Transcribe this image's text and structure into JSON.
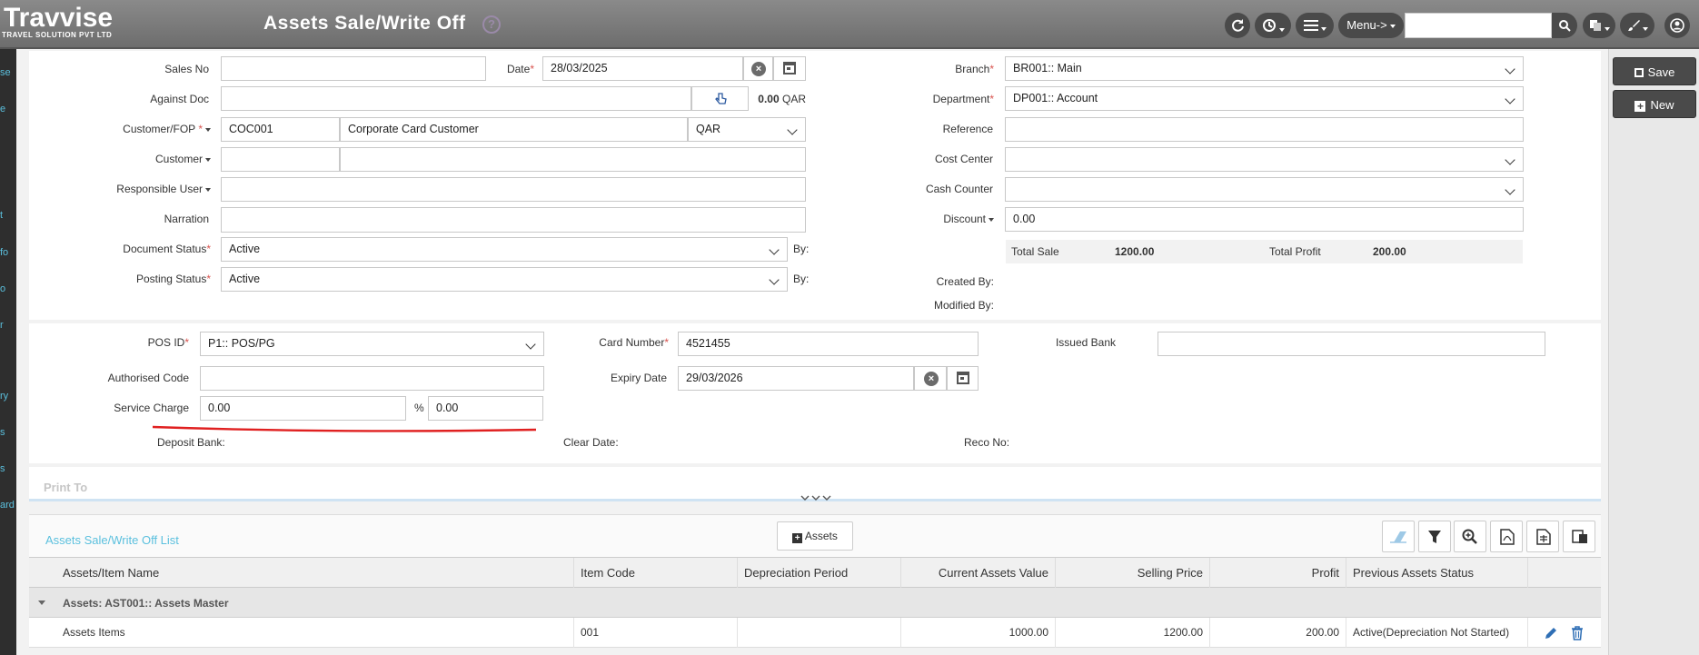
{
  "app": {
    "logo": "Travvise",
    "logo_sub": "TRAVEL SOLUTION PVT LTD",
    "title": "Assets Sale/Write Off",
    "help": "?",
    "menu_label": "Menu->",
    "search_placeholder": ""
  },
  "leftnav": [
    "se",
    "e",
    "t",
    "fo",
    "o",
    "r",
    "ry",
    "s",
    "s",
    "ard"
  ],
  "actions": {
    "save": "Save",
    "new": "New"
  },
  "form": {
    "sales_no": {
      "label": "Sales No",
      "value": ""
    },
    "date": {
      "label": "Date",
      "value": "28/03/2025"
    },
    "against_doc": {
      "label": "Against Doc",
      "amount": "0.00",
      "currency": "QAR"
    },
    "customer_fop": {
      "label": "Customer/FOP",
      "code": "COC001",
      "name": "Corporate Card Customer",
      "currency": "QAR"
    },
    "customer": {
      "label": "Customer",
      "code": "",
      "name": ""
    },
    "responsible_user": {
      "label": "Responsible User",
      "value": ""
    },
    "narration": {
      "label": "Narration",
      "value": ""
    },
    "document_status": {
      "label": "Document Status",
      "value": "Active",
      "by_label": "By:"
    },
    "posting_status": {
      "label": "Posting Status",
      "value": "Active",
      "by_label": "By:"
    },
    "branch": {
      "label": "Branch",
      "value": "BR001:: Main"
    },
    "department": {
      "label": "Department",
      "value": "DP001:: Account"
    },
    "reference": {
      "label": "Reference",
      "value": ""
    },
    "cost_center": {
      "label": "Cost Center",
      "value": ""
    },
    "cash_counter": {
      "label": "Cash Counter",
      "value": ""
    },
    "discount": {
      "label": "Discount",
      "value": "0.00"
    },
    "total_sale": {
      "label": "Total Sale",
      "value": "1200.00"
    },
    "total_profit": {
      "label": "Total Profit",
      "value": "200.00"
    },
    "created_by": "Created By:",
    "modified_by": "Modified By:"
  },
  "pos": {
    "pos_id": {
      "label": "POS ID",
      "value": "P1:: POS/PG"
    },
    "card_number": {
      "label": "Card Number",
      "value": "4521455"
    },
    "issued_bank": {
      "label": "Issued Bank",
      "value": ""
    },
    "authorised_code": {
      "label": "Authorised Code",
      "value": ""
    },
    "expiry_date": {
      "label": "Expiry Date",
      "value": "29/03/2026"
    },
    "service_charge": {
      "label": "Service Charge",
      "value": "0.00",
      "percent_symbol": "%",
      "percent": "0.00"
    },
    "deposit_bank": "Deposit Bank:",
    "clear_date": "Clear Date:",
    "reco_no": "Reco No:"
  },
  "print_to": "Print To",
  "list": {
    "title": "Assets Sale/Write Off List",
    "add_button": "Assets",
    "columns": [
      "Assets/Item Name",
      "Item Code",
      "Depreciation Period",
      "Current Assets Value",
      "Selling Price",
      "Profit",
      "Previous Assets Status"
    ],
    "group": "Assets: AST001:: Assets Master",
    "rows": [
      {
        "name": "Assets Items",
        "code": "001",
        "period": "",
        "current_value": "1000.00",
        "selling_price": "1200.00",
        "profit": "200.00",
        "status": "Active(Depreciation Not Started)"
      }
    ]
  },
  "colors": {
    "topbar": "#7a7a7a",
    "accent": "#5bc0de",
    "required": "#d9534f",
    "annotation": "#e02020"
  }
}
